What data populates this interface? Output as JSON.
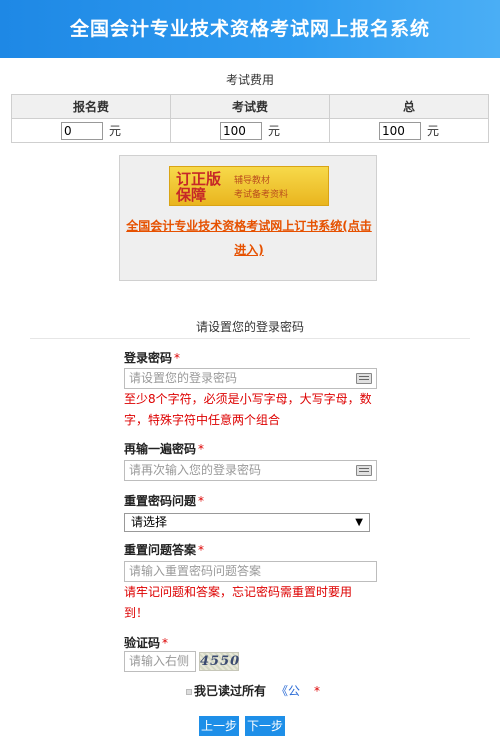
{
  "header": {
    "title": "全国会计专业技术资格考试网上报名系统"
  },
  "fees": {
    "caption": "考试费用",
    "columns": [
      "报名费",
      "考试费",
      "总"
    ],
    "values": [
      "0",
      "100",
      "100"
    ],
    "unit": "元"
  },
  "book": {
    "banner_big_line1": "订正版",
    "banner_big_line2": "保障",
    "banner_small_line1": "辅导教材",
    "banner_small_line2": "考试备考资料",
    "link": "全国会计专业技术资格考试网上订书系统(点击进入)"
  },
  "password_section": {
    "title": "请设置您的登录密码",
    "password_label": "登录密码",
    "password_placeholder": "请设置您的登录密码",
    "password_hint": "至少8个字符，必须是小写字母，大写字母，数字，特殊字符中任意两个组合",
    "confirm_label": "再输一遍密码",
    "confirm_placeholder": "请再次输入您的登录密码",
    "question_label": "重置密码问题",
    "question_selected": "请选择",
    "answer_label": "重置问题答案",
    "answer_placeholder": "请输入重置密码问题答案",
    "answer_hint": "请牢记问题和答案，忘记密码需重置时要用到！",
    "captcha_label": "验证码",
    "captcha_placeholder": "请输入右侧",
    "captcha_code": "4550",
    "required_mark": "*"
  },
  "agreement": {
    "text": "我已读过所有",
    "link": "《公"
  },
  "buttons": {
    "prev": "上一步",
    "next": "下一步"
  }
}
